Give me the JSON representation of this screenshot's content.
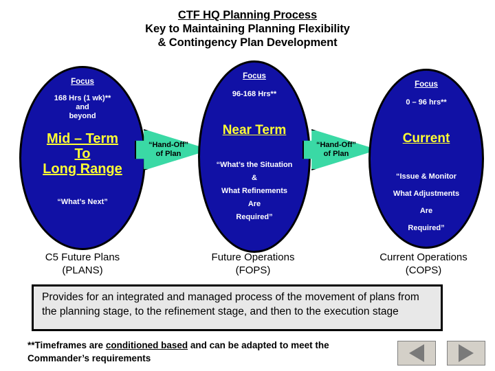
{
  "title": {
    "line1": "CTF HQ Planning Process",
    "line2": "Key to Maintaining Planning Flexibility",
    "line3": "& Contingency Plan Development"
  },
  "colors": {
    "ellipse_fill": "#1111a5",
    "ellipse_border": "#000000",
    "phase_title": "#ffff33",
    "arrow_fill": "#3ad9a5",
    "summary_bg": "#e8e8e8",
    "nav_button_bg": "#d4d0c8",
    "nav_triangle": "#7a7a7a"
  },
  "stages": [
    {
      "id": "plans",
      "focus_label": "Focus",
      "timeframe": "168 Hrs (1 wk)**\nand\nbeyond",
      "phase_title": "Mid – Term\nTo\nLong Range",
      "question": "“What’s Next”",
      "caption": "C5 Future Plans\n(PLANS)"
    },
    {
      "id": "fops",
      "focus_label": "Focus",
      "timeframe": "96-168 Hrs**",
      "phase_title": "Near Term",
      "question": "“What’s the Situation\n&\nWhat Refinements\nAre\nRequired”",
      "caption": "Future Operations\n(FOPS)"
    },
    {
      "id": "cops",
      "focus_label": "Focus",
      "timeframe": "0 – 96 hrs**",
      "phase_title": "Current",
      "question": "“Issue & Monitor\nWhat Adjustments\nAre\nRequired”",
      "caption": "Current Operations\n(COPS)"
    }
  ],
  "handoffs": [
    {
      "id": "handoff-1",
      "line1": "“Hand-Off”",
      "line2": "of Plan"
    },
    {
      "id": "handoff-2",
      "line1": "“Hand-Off”",
      "line2": "of Plan"
    }
  ],
  "summary": {
    "text": "Provides for an integrated and managed process of the movement of plans from the planning stage, to the refinement stage, and then to the execution stage"
  },
  "footnote": {
    "before": "**Timeframes are ",
    "underlined": "conditioned based",
    "after": " and can be adapted to meet the Commander’s requirements"
  },
  "nav": {
    "prev_label": "previous-slide",
    "next_label": "next-slide"
  }
}
